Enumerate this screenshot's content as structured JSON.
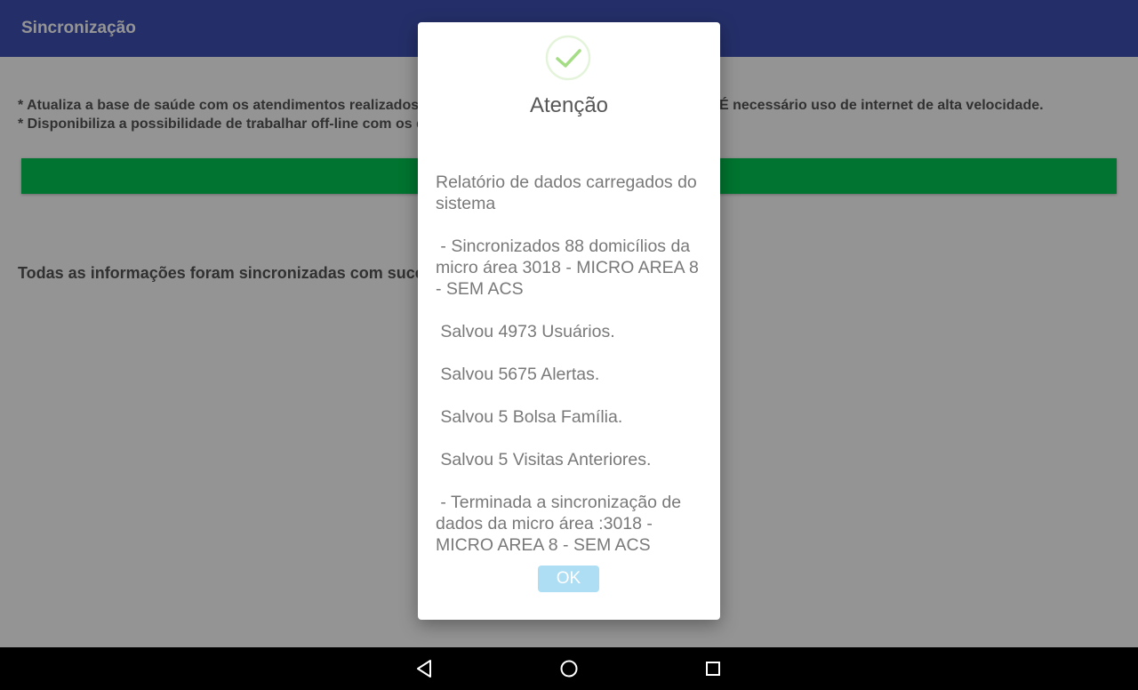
{
  "app": {
    "title": "Sincronização"
  },
  "main": {
    "description_lines": [
      "* Atualiza a base de saúde com os atendimentos realizados. Esse processo pode levar alguns minutos. É necessário uso de internet de alta velocidade.",
      "* Disponibiliza a possibilidade de trabalhar off-line com os dados sincronizados."
    ],
    "progress": 1.0,
    "progress_color": "#00c853",
    "status_text": "Todas as informações foram sincronizadas com sucesso."
  },
  "dialog": {
    "icon": "check-circle-icon",
    "icon_color": "#a5dc86",
    "title": "Atenção",
    "report_paragraphs": [
      "Relatório de dados carregados do sistema",
      " - Sincronizados 88 domicílios da micro área 3018 - MICRO AREA 8 - SEM ACS",
      " Salvou 4973 Usuários.",
      " Salvou 5675 Alertas.",
      " Salvou 5 Bolsa Família.",
      " Salvou 5 Visitas Anteriores.",
      " - Terminada a sincronização de dados da micro área :3018 - MICRO AREA 8 - SEM ACS"
    ],
    "ok_label": "OK",
    "ok_color": "#aedef4"
  },
  "navbar": {
    "back_icon": "back-triangle-icon",
    "home_icon": "home-circle-icon",
    "recents_icon": "recents-square-icon"
  }
}
